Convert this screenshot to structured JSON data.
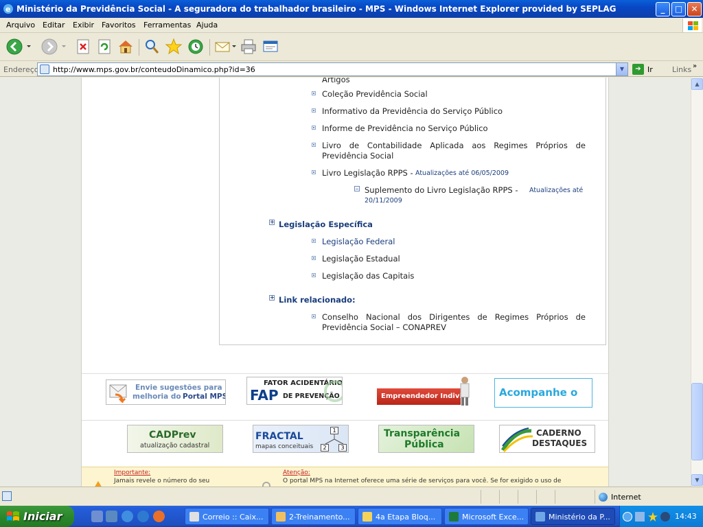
{
  "window": {
    "title": "Ministério da Previdência Social - A seguradora do trabalhador brasileiro - MPS - Windows Internet Explorer provided by SEPLAG",
    "controls": {
      "minimize": "_",
      "maximize": "□",
      "close": "✕"
    }
  },
  "menu": [
    "Arquivo",
    "Editar",
    "Exibir",
    "Favoritos",
    "Ferramentas",
    "Ajuda"
  ],
  "address": {
    "label": "Endereço",
    "url": "http://www.mps.gov.br/conteudoDinamico.php?id=36",
    "go_label": "Ir",
    "links_label": "Links"
  },
  "content": {
    "partial_top": "Artigos",
    "items_top": [
      "Coleção Previdência Social",
      "Informativo da Previdência do Serviço Público",
      "Informe de Previdência no Serviço Público"
    ],
    "livro_contab_line1": "Livro de Contabilidade Aplicada aos Regimes Próprios de",
    "livro_contab_line2": "Previdência Social",
    "livro_rpps": "Livro Legislação RPPS -",
    "livro_rpps_update": "Atualizações até 06/05/2009",
    "suplemento": "Suplemento do Livro Legislação RPPS -",
    "suplemento_update_a": "Atualizações até",
    "suplemento_update_b": "20/11/2009",
    "section_especifica": "Legislação Específica",
    "items_especifica": [
      "Legislação Federal",
      "Legislação Estadual",
      "Legislação das Capitais"
    ],
    "section_link": "Link relacionado:",
    "conselho_line1": "Conselho Nacional dos Dirigentes de Regimes Próprios de",
    "conselho_line2": "Previdência Social – CONAPREV"
  },
  "banners": {
    "sugestoes_line1": "Envie sugestões para",
    "sugestoes_line2_a": "melhoria do",
    "sugestoes_line2_b": "Portal MPS",
    "fap_title": "FATOR ACIDENTÁRIO",
    "fap_abbr": "FAP",
    "fap_sub": "DE PREVENÇÃO",
    "empreendedor": "Empreendedor Individual",
    "acompanhe": "Acompanhe o",
    "cadprev_title": "CADPrev",
    "cadprev_sub": "atualização cadastral",
    "fractal_title": "FRACTAL",
    "fractal_sub": "mapas conceituais",
    "fractal_nodes": [
      "1",
      "2",
      "3"
    ],
    "transparencia_line1": "Transparência",
    "transparencia_line2": "Pública",
    "caderno_line1": "CADERNO",
    "caderno_line2": "DESTAQUES"
  },
  "footer": {
    "importante_label": "Importante:",
    "importante_text": "Jamais revele o número do seu",
    "atencao_label": "Atenção:",
    "atencao_text": "O portal MPS na Internet oferece uma série de serviços para você. Se for exigido o uso de"
  },
  "statusbar": {
    "zone": "Internet"
  },
  "taskbar": {
    "start": "Iniciar",
    "tasks": [
      {
        "label": "Correio :: Caix...",
        "color": "#e0e0e0"
      },
      {
        "label": "2-Treinamento...",
        "color": "#f0c060"
      },
      {
        "label": "4a Etapa Bloq...",
        "color": "#f5d35a"
      },
      {
        "label": "Microsoft Exce...",
        "color": "#1e7a3a"
      },
      {
        "label": "Ministério da P...",
        "color": "#6fa7e6"
      }
    ],
    "clock": "14:43"
  },
  "colors": {
    "link_blue": "#1a3d7c",
    "xp_blue": "#0847c4",
    "start_green": "#2e8b2e"
  }
}
